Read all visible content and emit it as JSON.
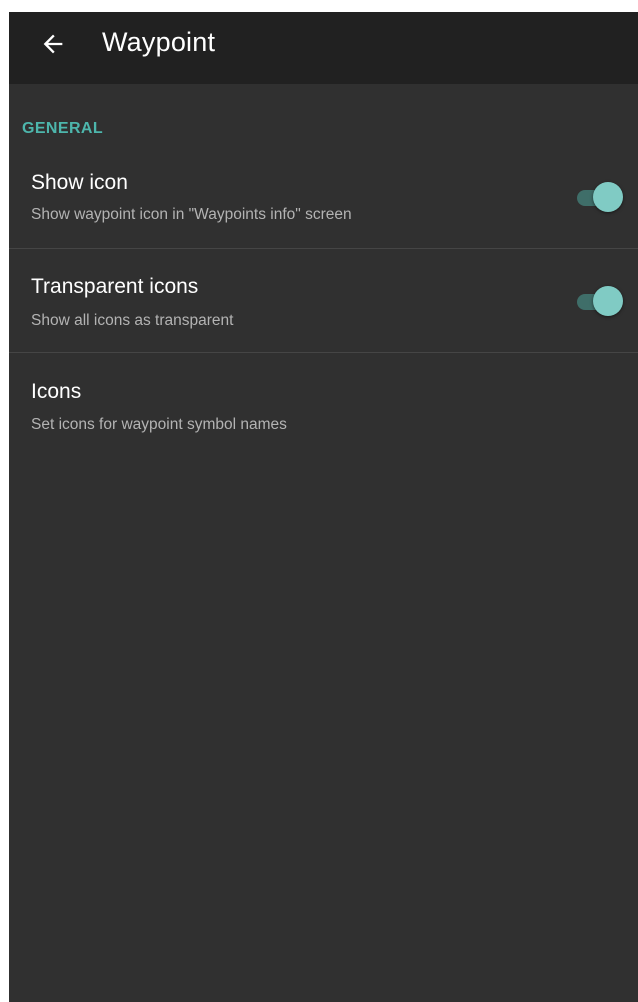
{
  "appbar": {
    "title": "Waypoint",
    "back_icon": "arrow-left-icon"
  },
  "colors": {
    "background": "#303030",
    "appbar": "#212121",
    "accent": "#4db6ac",
    "switch_thumb": "#80cbc4",
    "switch_track": "#3f6e69"
  },
  "section": {
    "header": "GENERAL"
  },
  "preferences": [
    {
      "title": "Show icon",
      "summary": "Show waypoint icon in \"Waypoints info\" screen",
      "switch_on": true
    },
    {
      "title": "Transparent icons",
      "summary": "Show all icons as transparent",
      "switch_on": true
    },
    {
      "title": "Icons",
      "summary": "Set icons for waypoint symbol names"
    }
  ]
}
